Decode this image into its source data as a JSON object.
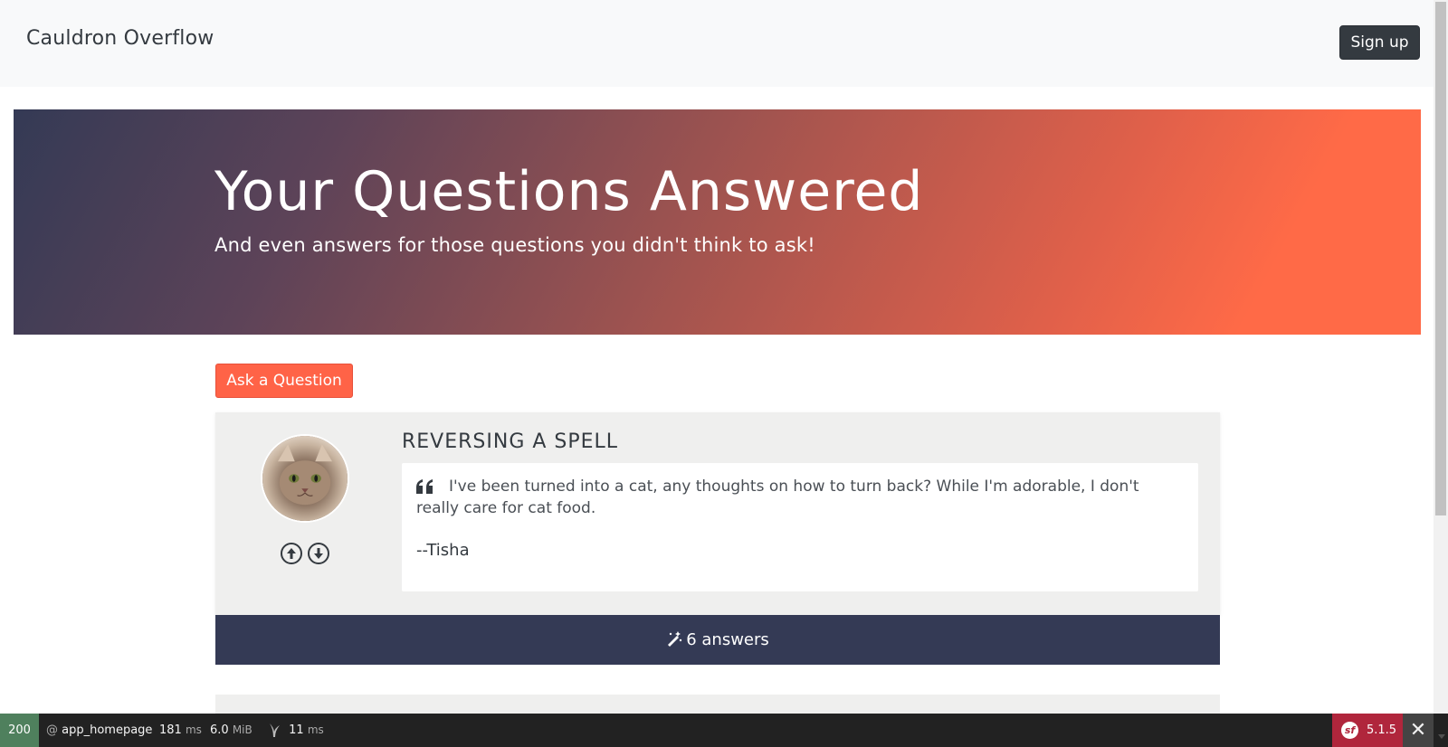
{
  "navbar": {
    "brand": "Cauldron Overflow",
    "signup_label": "Sign up"
  },
  "hero": {
    "title": "Your Questions Answered",
    "subtitle": "And even answers for those questions you didn't think to ask!"
  },
  "actions": {
    "ask_label": "Ask a Question"
  },
  "question": {
    "title": "Reversing a Spell",
    "text": "I've been turned into a cat, any thoughts on how to turn back? While I'm adorable, I don't really care for cat food.",
    "author": "--Tisha",
    "answers_label": "6 answers",
    "icons": [
      "upvote-icon",
      "downvote-icon",
      "quote-icon",
      "wand-icon"
    ]
  },
  "debug_toolbar": {
    "status": "200",
    "route_prefix": "@",
    "route": "app_homepage",
    "time_value": "181",
    "time_unit": "ms",
    "memory_value": "6.0",
    "memory_unit": "MiB",
    "twig_value": "11",
    "twig_unit": "ms",
    "symfony_version": "5.1.5",
    "colors": {
      "status_bg": "#4f805d",
      "version_bg": "#b0263c"
    }
  },
  "colors": {
    "accent": "#ff6347",
    "navy": "#343a55",
    "card_bg": "#efefee"
  }
}
